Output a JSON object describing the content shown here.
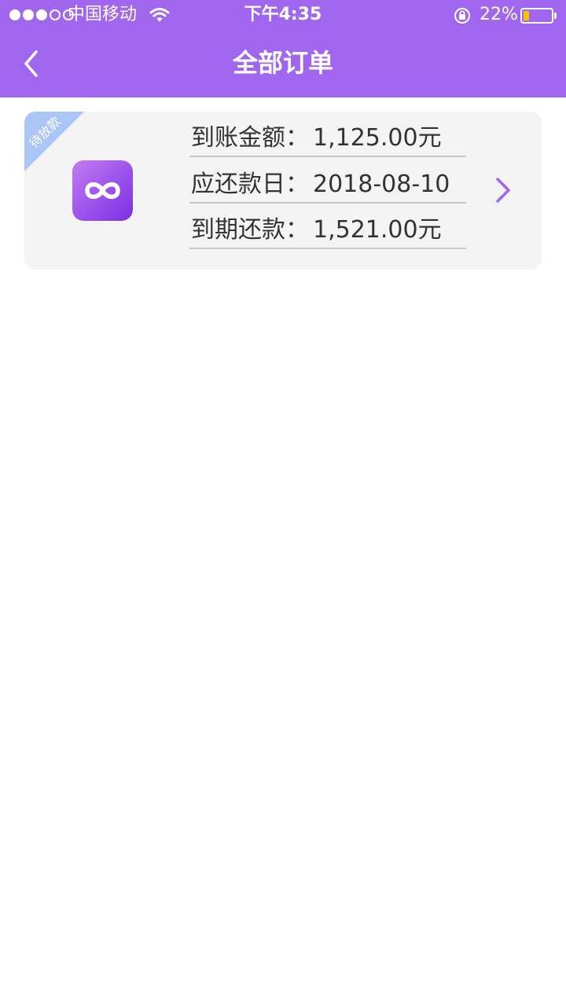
{
  "status_bar": {
    "carrier": "中国移动",
    "time": "下午4:35",
    "battery_percent": "22%",
    "battery_level": 0.22,
    "signal_bars": 3,
    "signal_total": 5
  },
  "nav": {
    "title": "全部订单",
    "back_icon": "chevron-left-icon"
  },
  "order": {
    "status_ribbon": "待放款",
    "rows": [
      {
        "label": "到账金额：",
        "value": "1,125.00元"
      },
      {
        "label": "应还款日：",
        "value": "2018-08-10"
      },
      {
        "label": "到期还款：",
        "value": "1,521.00元"
      }
    ],
    "arrow_icon": "chevron-right-icon"
  },
  "colors": {
    "header": "#a066ee",
    "ribbon": "#a9c6f7",
    "chevron": "#a066ee",
    "card_bg": "#f4f4f4"
  }
}
